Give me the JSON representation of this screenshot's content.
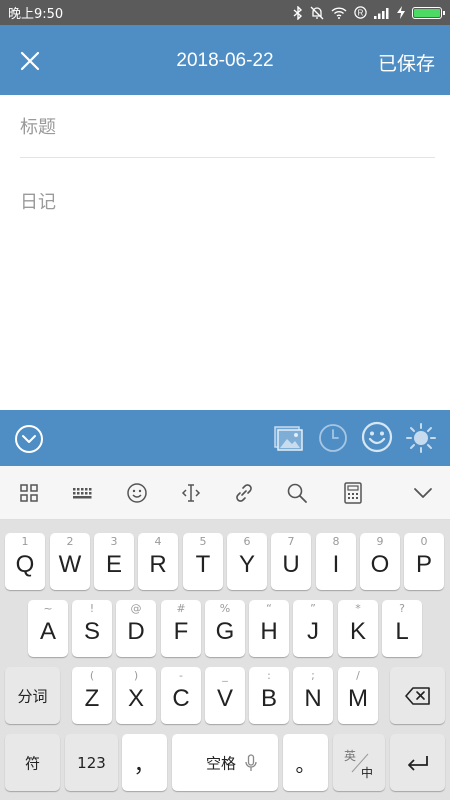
{
  "status_bar": {
    "time": "晚上9:50"
  },
  "header": {
    "title": "2018-06-22",
    "save_status": "已保存"
  },
  "editor": {
    "title_placeholder": "标题",
    "body_placeholder": "日记"
  },
  "edit_toolbar": [
    "collapse-icon",
    "image-icon",
    "clock-icon",
    "emoji-icon",
    "weather-sun-icon"
  ],
  "ime_toolbar": [
    "grid-icon",
    "keyboard-icon",
    "emoji-icon",
    "cursor-icon",
    "link-icon",
    "search-icon",
    "calculator-icon",
    "chevron-down-icon"
  ],
  "keyboard": {
    "row1": [
      {
        "k": "Q",
        "h": "1"
      },
      {
        "k": "W",
        "h": "2"
      },
      {
        "k": "E",
        "h": "3"
      },
      {
        "k": "R",
        "h": "4"
      },
      {
        "k": "T",
        "h": "5"
      },
      {
        "k": "Y",
        "h": "6"
      },
      {
        "k": "U",
        "h": "7"
      },
      {
        "k": "I",
        "h": "8"
      },
      {
        "k": "O",
        "h": "9"
      },
      {
        "k": "P",
        "h": "0"
      }
    ],
    "row2": [
      {
        "k": "A",
        "h": "~"
      },
      {
        "k": "S",
        "h": "!"
      },
      {
        "k": "D",
        "h": "@"
      },
      {
        "k": "F",
        "h": "#"
      },
      {
        "k": "G",
        "h": "%"
      },
      {
        "k": "H",
        "h": "“"
      },
      {
        "k": "J",
        "h": "”"
      },
      {
        "k": "K",
        "h": "*"
      },
      {
        "k": "L",
        "h": "?"
      }
    ],
    "row3": [
      {
        "k": "Z",
        "h": "("
      },
      {
        "k": "X",
        "h": ")"
      },
      {
        "k": "C",
        "h": "-"
      },
      {
        "k": "V",
        "h": "_"
      },
      {
        "k": "B",
        "h": ":"
      },
      {
        "k": "N",
        "h": ";"
      },
      {
        "k": "M",
        "h": "/"
      }
    ],
    "fenci": "分词",
    "fu": "符",
    "num": "123",
    "comma": "，",
    "space": "空格",
    "period": "。",
    "lang_en": "英",
    "lang_zh": "中"
  }
}
